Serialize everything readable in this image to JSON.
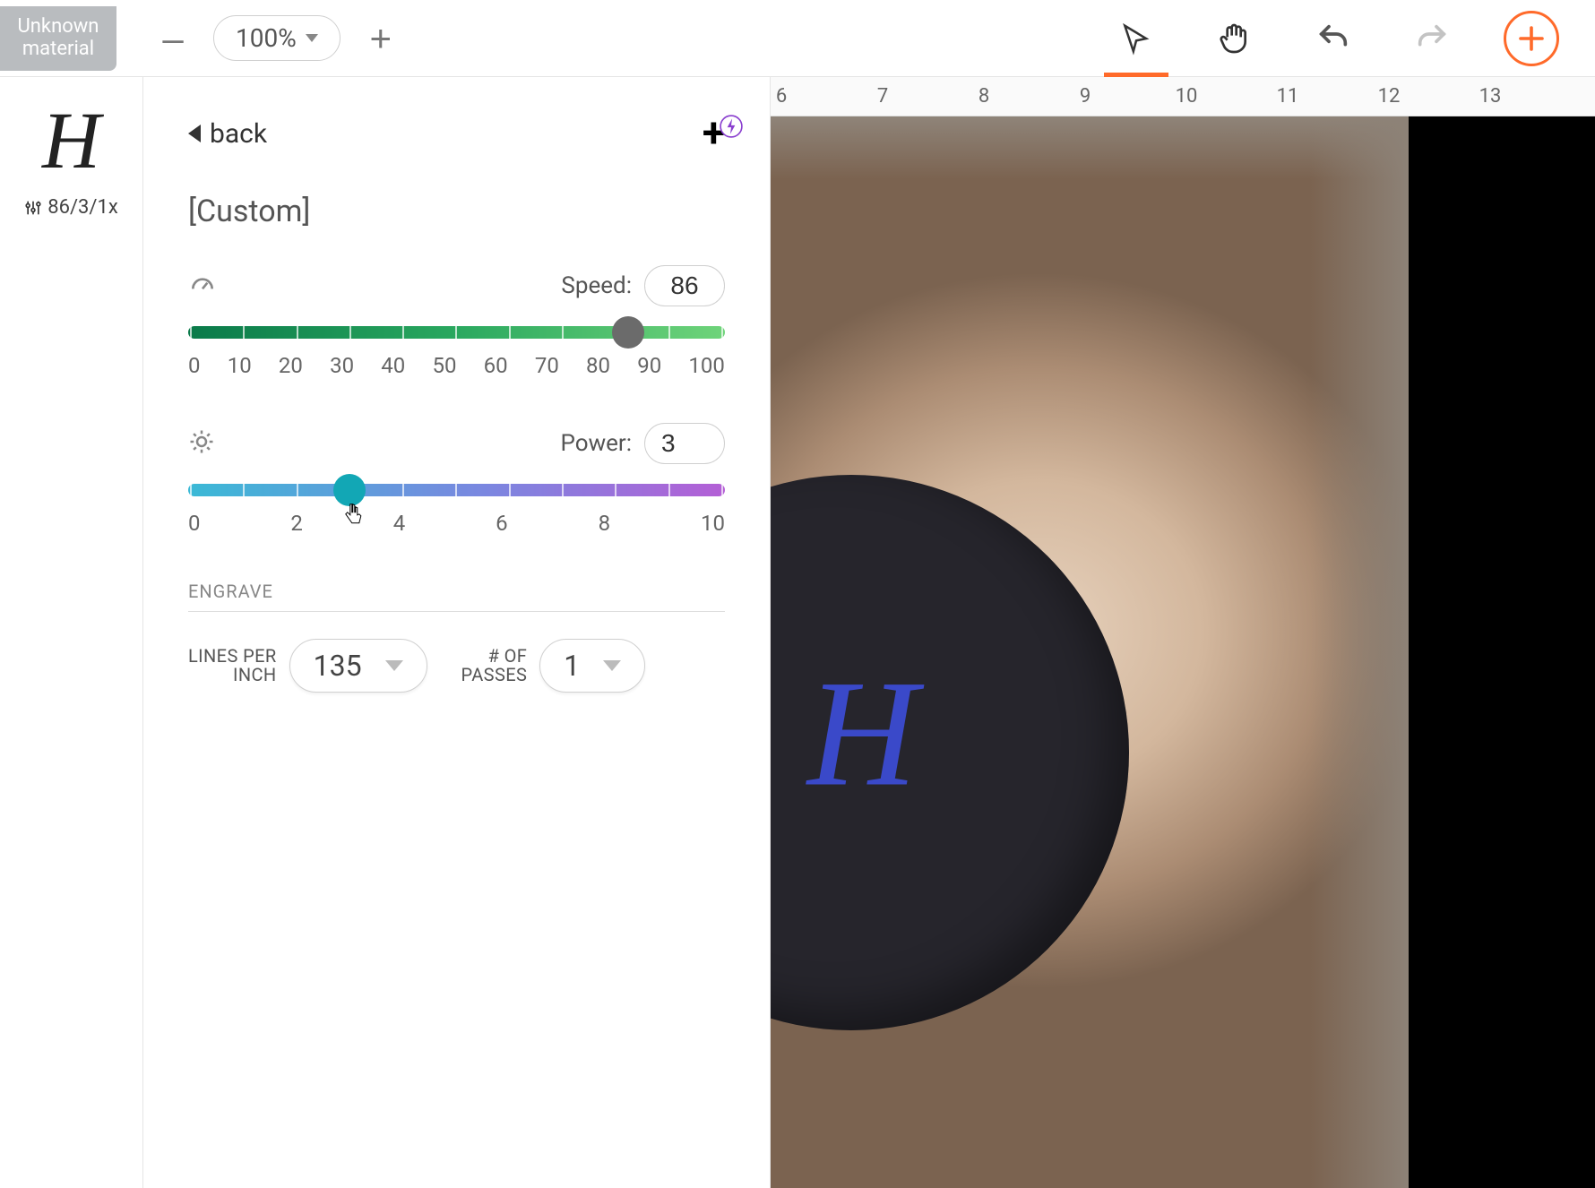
{
  "topbar": {
    "material_label": "Unknown material",
    "zoom_minus": "–",
    "zoom_value": "100%",
    "zoom_plus": "+"
  },
  "layer": {
    "thumb_letter": "H",
    "meta": "86/3/1x"
  },
  "panel": {
    "back_label": "back",
    "preset_name": "[Custom]",
    "speed": {
      "label": "Speed:",
      "value": "86",
      "ticks": [
        "0",
        "10",
        "20",
        "30",
        "40",
        "50",
        "60",
        "70",
        "80",
        "90",
        "100"
      ],
      "percent": 82
    },
    "power": {
      "label": "Power:",
      "value": "3",
      "ticks": [
        "0",
        "2",
        "4",
        "6",
        "8",
        "10"
      ],
      "percent": 30
    },
    "section": "ENGRAVE",
    "lpi": {
      "label_line1": "LINES PER",
      "label_line2": "INCH",
      "value": "135"
    },
    "passes": {
      "label_line1": "# OF",
      "label_line2": "PASSES",
      "value": "1"
    }
  },
  "ruler": {
    "numbers": [
      "6",
      "7",
      "8",
      "9",
      "10",
      "11",
      "12",
      "13"
    ]
  },
  "canvas": {
    "letter": "H"
  }
}
